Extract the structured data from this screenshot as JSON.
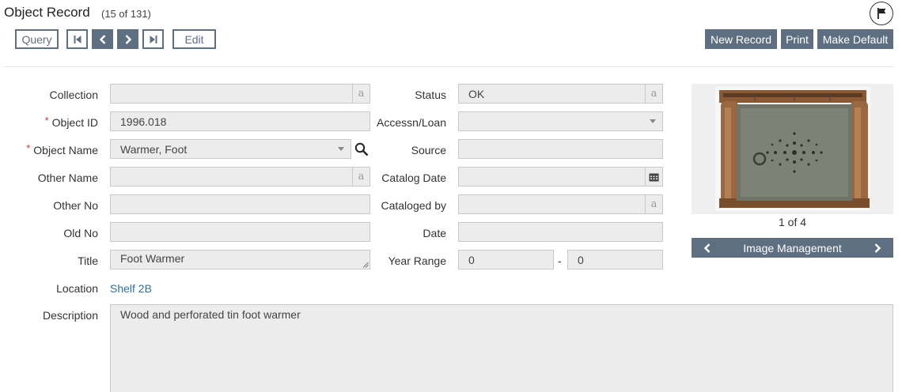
{
  "header": {
    "title": "Object Record",
    "record_count": "(15 of 131)",
    "flag_icon": "flag-icon"
  },
  "toolbar": {
    "query_label": "Query",
    "edit_label": "Edit",
    "new_record_label": "New Record",
    "print_label": "Print",
    "make_default_label": "Make Default",
    "nav_icons": [
      "first-record-icon",
      "prev-record-icon",
      "next-record-icon",
      "last-record-icon"
    ]
  },
  "left_fields": {
    "collection": {
      "label": "Collection",
      "value": ""
    },
    "object_id": {
      "label": "Object ID",
      "value": "1996.018",
      "required": "*"
    },
    "object_name": {
      "label": "Object Name",
      "value": "Warmer, Foot",
      "required": "*"
    },
    "other_name": {
      "label": "Other Name",
      "value": ""
    },
    "other_no": {
      "label": "Other No",
      "value": ""
    },
    "old_no": {
      "label": "Old No",
      "value": ""
    },
    "title": {
      "label": "Title",
      "value": "Foot Warmer"
    },
    "location": {
      "label": "Location",
      "value": "Shelf 2B"
    },
    "description": {
      "label": "Description",
      "value": "Wood and perforated tin foot warmer"
    }
  },
  "right_fields": {
    "status": {
      "label": "Status",
      "value": "OK"
    },
    "accessn_loan": {
      "label": "Accessn/Loan",
      "value": ""
    },
    "source": {
      "label": "Source",
      "value": ""
    },
    "catalog_date": {
      "label": "Catalog Date",
      "value": ""
    },
    "cataloged_by": {
      "label": "Cataloged by",
      "value": ""
    },
    "date": {
      "label": "Date",
      "value": ""
    },
    "year_range": {
      "label": "Year Range",
      "from": "0",
      "to": "0",
      "separator": "-"
    }
  },
  "field_marker": "a",
  "image": {
    "counter": "1 of 4",
    "management_label": "Image Management"
  },
  "colors": {
    "button_dark": "#5f6f82",
    "field_bg": "#ececec",
    "link": "#2f6fa3",
    "required": "#c0392b"
  }
}
